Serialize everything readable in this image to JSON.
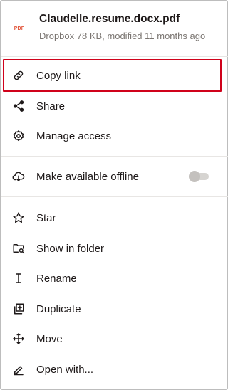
{
  "file": {
    "icon_label": "PDF",
    "name": "Claudelle.resume.docx.pdf",
    "meta": "Dropbox 78 KB, modified 11 months ago"
  },
  "menu": {
    "copy_link": "Copy link",
    "share": "Share",
    "manage_access": "Manage access",
    "make_offline": "Make available offline",
    "star": "Star",
    "show_in_folder": "Show in folder",
    "rename": "Rename",
    "duplicate": "Duplicate",
    "move": "Move",
    "open_with": "Open with..."
  },
  "offline_toggle": {
    "state": "off"
  },
  "colors": {
    "accent_highlight": "#d0021b",
    "pdf_red": "#e2583e",
    "text": "#1e1919",
    "secondary_text": "#7a7571"
  }
}
